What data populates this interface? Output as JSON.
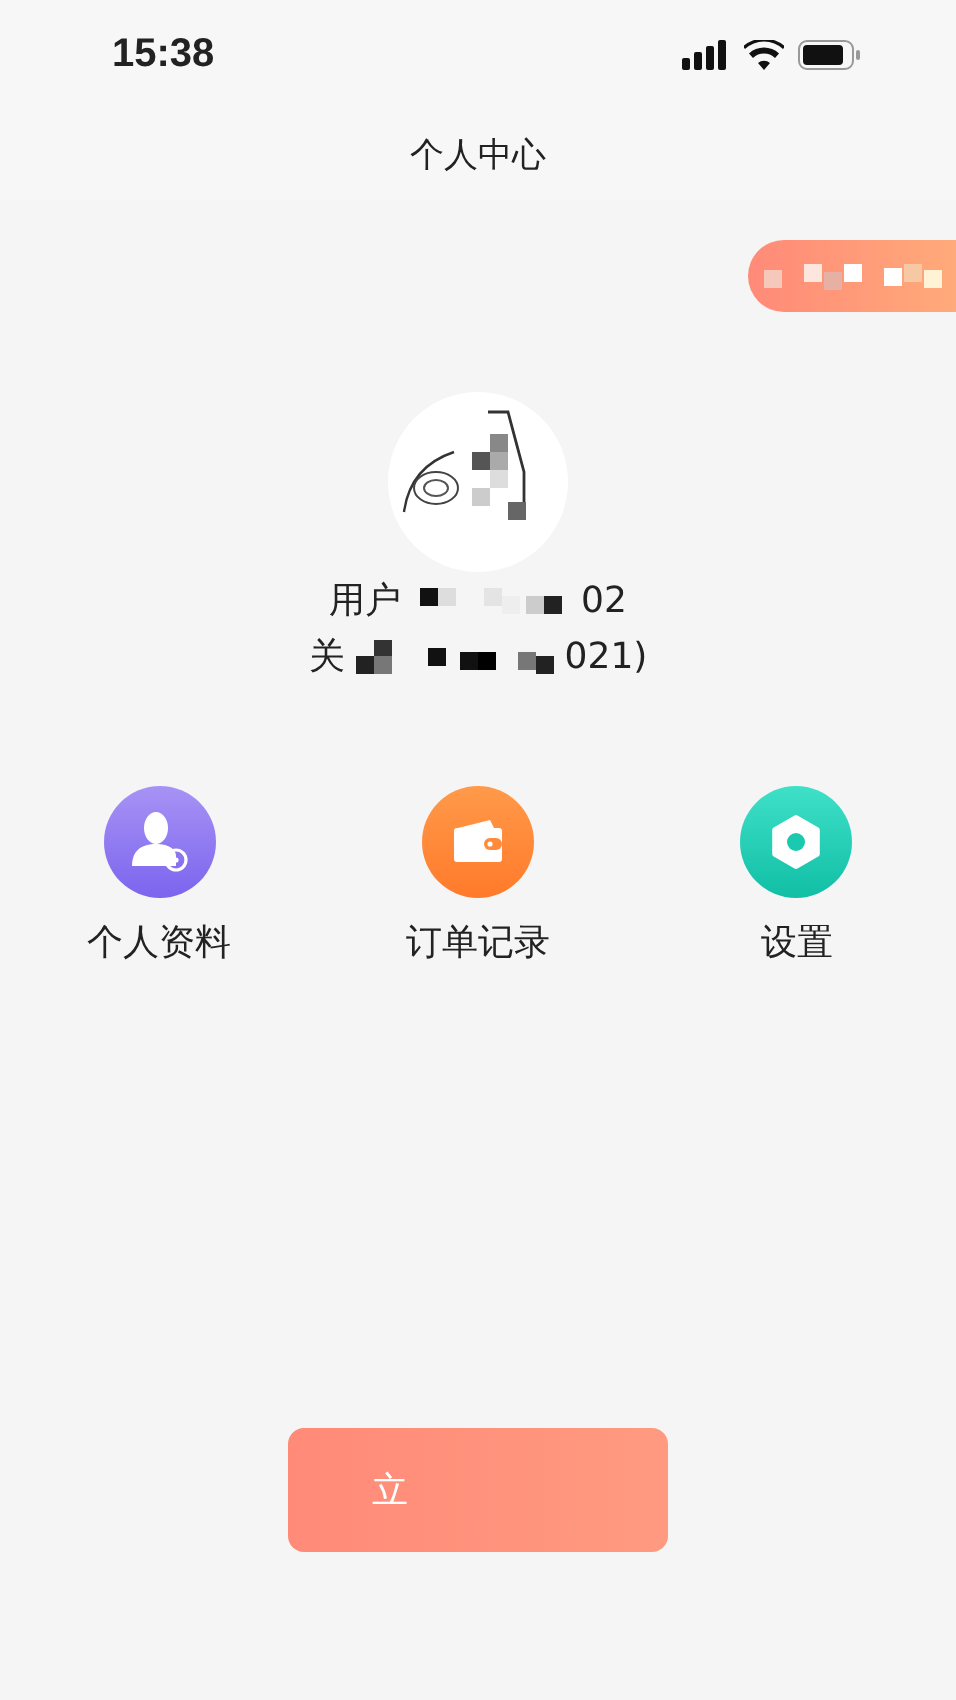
{
  "status_bar": {
    "time": "15:38"
  },
  "nav": {
    "title": "个人中心"
  },
  "profile": {
    "name_start": "用户",
    "name_end": "02",
    "detail_start": "关",
    "detail_end": "021)"
  },
  "menu": [
    {
      "kind": "profile",
      "label": "个人资料"
    },
    {
      "kind": "orders",
      "label": "订单记录"
    },
    {
      "kind": "settings",
      "label": "设置"
    }
  ],
  "action_button": {
    "label": "立"
  }
}
